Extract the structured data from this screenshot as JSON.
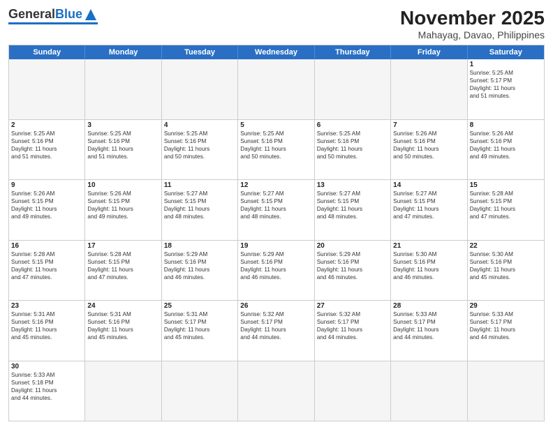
{
  "logo": {
    "general": "General",
    "blue": "Blue"
  },
  "title": "November 2025",
  "subtitle": "Mahayag, Davao, Philippines",
  "header_days": [
    "Sunday",
    "Monday",
    "Tuesday",
    "Wednesday",
    "Thursday",
    "Friday",
    "Saturday"
  ],
  "rows": [
    [
      {
        "day": "",
        "empty": true,
        "text": ""
      },
      {
        "day": "",
        "empty": true,
        "text": ""
      },
      {
        "day": "",
        "empty": true,
        "text": ""
      },
      {
        "day": "",
        "empty": true,
        "text": ""
      },
      {
        "day": "",
        "empty": true,
        "text": ""
      },
      {
        "day": "",
        "empty": true,
        "text": ""
      },
      {
        "day": "1",
        "empty": false,
        "text": "Sunrise: 5:25 AM\nSunset: 5:17 PM\nDaylight: 11 hours\nand 51 minutes."
      }
    ],
    [
      {
        "day": "2",
        "empty": false,
        "text": "Sunrise: 5:25 AM\nSunset: 5:16 PM\nDaylight: 11 hours\nand 51 minutes."
      },
      {
        "day": "3",
        "empty": false,
        "text": "Sunrise: 5:25 AM\nSunset: 5:16 PM\nDaylight: 11 hours\nand 51 minutes."
      },
      {
        "day": "4",
        "empty": false,
        "text": "Sunrise: 5:25 AM\nSunset: 5:16 PM\nDaylight: 11 hours\nand 50 minutes."
      },
      {
        "day": "5",
        "empty": false,
        "text": "Sunrise: 5:25 AM\nSunset: 5:16 PM\nDaylight: 11 hours\nand 50 minutes."
      },
      {
        "day": "6",
        "empty": false,
        "text": "Sunrise: 5:25 AM\nSunset: 5:16 PM\nDaylight: 11 hours\nand 50 minutes."
      },
      {
        "day": "7",
        "empty": false,
        "text": "Sunrise: 5:26 AM\nSunset: 5:16 PM\nDaylight: 11 hours\nand 50 minutes."
      },
      {
        "day": "8",
        "empty": false,
        "text": "Sunrise: 5:26 AM\nSunset: 5:16 PM\nDaylight: 11 hours\nand 49 minutes."
      }
    ],
    [
      {
        "day": "9",
        "empty": false,
        "text": "Sunrise: 5:26 AM\nSunset: 5:15 PM\nDaylight: 11 hours\nand 49 minutes."
      },
      {
        "day": "10",
        "empty": false,
        "text": "Sunrise: 5:26 AM\nSunset: 5:15 PM\nDaylight: 11 hours\nand 49 minutes."
      },
      {
        "day": "11",
        "empty": false,
        "text": "Sunrise: 5:27 AM\nSunset: 5:15 PM\nDaylight: 11 hours\nand 48 minutes."
      },
      {
        "day": "12",
        "empty": false,
        "text": "Sunrise: 5:27 AM\nSunset: 5:15 PM\nDaylight: 11 hours\nand 48 minutes."
      },
      {
        "day": "13",
        "empty": false,
        "text": "Sunrise: 5:27 AM\nSunset: 5:15 PM\nDaylight: 11 hours\nand 48 minutes."
      },
      {
        "day": "14",
        "empty": false,
        "text": "Sunrise: 5:27 AM\nSunset: 5:15 PM\nDaylight: 11 hours\nand 47 minutes."
      },
      {
        "day": "15",
        "empty": false,
        "text": "Sunrise: 5:28 AM\nSunset: 5:15 PM\nDaylight: 11 hours\nand 47 minutes."
      }
    ],
    [
      {
        "day": "16",
        "empty": false,
        "text": "Sunrise: 5:28 AM\nSunset: 5:15 PM\nDaylight: 11 hours\nand 47 minutes."
      },
      {
        "day": "17",
        "empty": false,
        "text": "Sunrise: 5:28 AM\nSunset: 5:15 PM\nDaylight: 11 hours\nand 47 minutes."
      },
      {
        "day": "18",
        "empty": false,
        "text": "Sunrise: 5:29 AM\nSunset: 5:16 PM\nDaylight: 11 hours\nand 46 minutes."
      },
      {
        "day": "19",
        "empty": false,
        "text": "Sunrise: 5:29 AM\nSunset: 5:16 PM\nDaylight: 11 hours\nand 46 minutes."
      },
      {
        "day": "20",
        "empty": false,
        "text": "Sunrise: 5:29 AM\nSunset: 5:16 PM\nDaylight: 11 hours\nand 46 minutes."
      },
      {
        "day": "21",
        "empty": false,
        "text": "Sunrise: 5:30 AM\nSunset: 5:16 PM\nDaylight: 11 hours\nand 46 minutes."
      },
      {
        "day": "22",
        "empty": false,
        "text": "Sunrise: 5:30 AM\nSunset: 5:16 PM\nDaylight: 11 hours\nand 45 minutes."
      }
    ],
    [
      {
        "day": "23",
        "empty": false,
        "text": "Sunrise: 5:31 AM\nSunset: 5:16 PM\nDaylight: 11 hours\nand 45 minutes."
      },
      {
        "day": "24",
        "empty": false,
        "text": "Sunrise: 5:31 AM\nSunset: 5:16 PM\nDaylight: 11 hours\nand 45 minutes."
      },
      {
        "day": "25",
        "empty": false,
        "text": "Sunrise: 5:31 AM\nSunset: 5:17 PM\nDaylight: 11 hours\nand 45 minutes."
      },
      {
        "day": "26",
        "empty": false,
        "text": "Sunrise: 5:32 AM\nSunset: 5:17 PM\nDaylight: 11 hours\nand 44 minutes."
      },
      {
        "day": "27",
        "empty": false,
        "text": "Sunrise: 5:32 AM\nSunset: 5:17 PM\nDaylight: 11 hours\nand 44 minutes."
      },
      {
        "day": "28",
        "empty": false,
        "text": "Sunrise: 5:33 AM\nSunset: 5:17 PM\nDaylight: 11 hours\nand 44 minutes."
      },
      {
        "day": "29",
        "empty": false,
        "text": "Sunrise: 5:33 AM\nSunset: 5:17 PM\nDaylight: 11 hours\nand 44 minutes."
      }
    ],
    [
      {
        "day": "30",
        "empty": false,
        "text": "Sunrise: 5:33 AM\nSunset: 5:18 PM\nDaylight: 11 hours\nand 44 minutes."
      },
      {
        "day": "",
        "empty": true,
        "text": ""
      },
      {
        "day": "",
        "empty": true,
        "text": ""
      },
      {
        "day": "",
        "empty": true,
        "text": ""
      },
      {
        "day": "",
        "empty": true,
        "text": ""
      },
      {
        "day": "",
        "empty": true,
        "text": ""
      },
      {
        "day": "",
        "empty": true,
        "text": ""
      }
    ]
  ]
}
